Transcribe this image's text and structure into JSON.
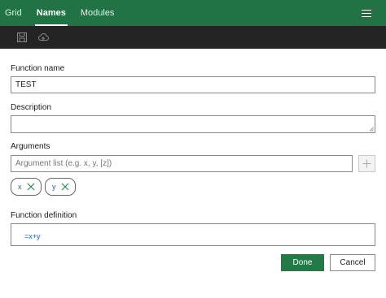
{
  "header": {
    "tabs": [
      {
        "label": "Grid"
      },
      {
        "label": "Names"
      },
      {
        "label": "Modules"
      }
    ],
    "active_tab": "Names",
    "menu_icon": "hamburger-menu-icon"
  },
  "toolbar": {
    "icons": [
      "save-icon",
      "cloud-upload-icon"
    ]
  },
  "form": {
    "function_name_label": "Function name",
    "function_name_value": "TEST",
    "description_label": "Description",
    "description_value": "",
    "arguments_label": "Arguments",
    "arguments_placeholder": "Argument list (e.g. x, y, [z])",
    "arguments": [
      {
        "name": "x"
      },
      {
        "name": "y"
      }
    ],
    "definition_label": "Function definition",
    "definition_value": "=x+y"
  },
  "actions": {
    "done_label": "Done",
    "cancel_label": "Cancel"
  },
  "colors": {
    "accent": "#217346",
    "toolbar": "#242424",
    "formula_text": "#1f5fb3"
  }
}
